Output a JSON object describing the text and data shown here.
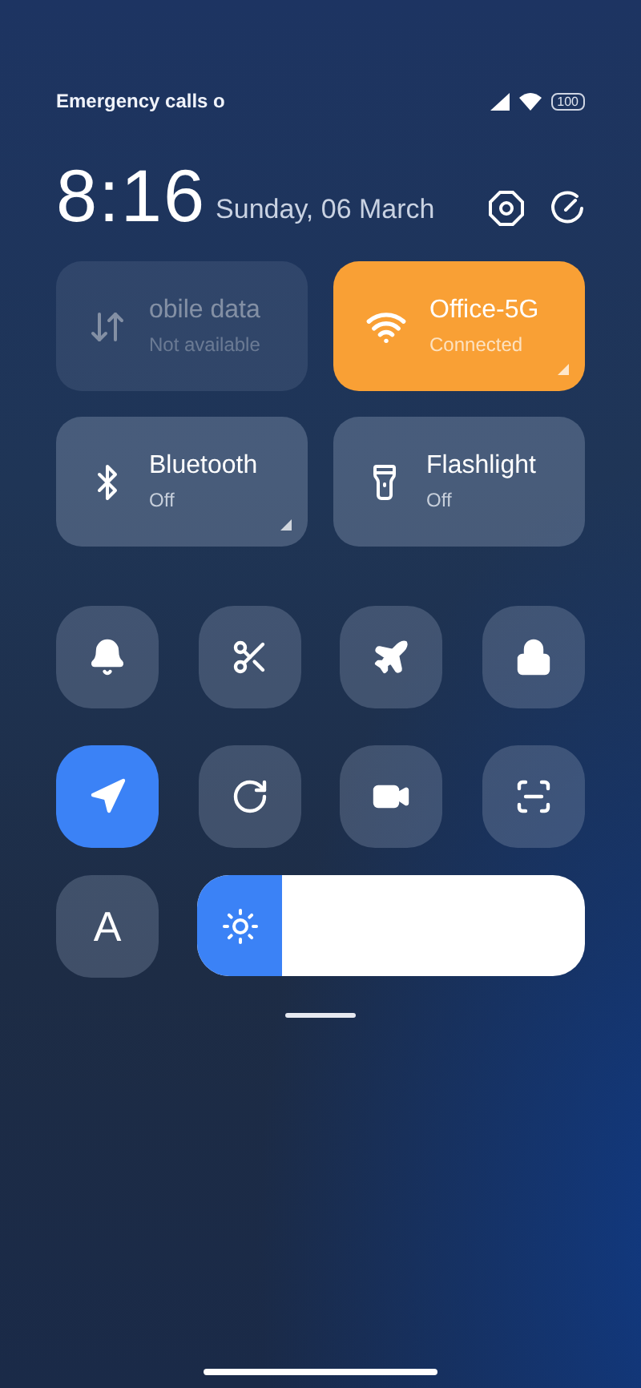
{
  "status_bar": {
    "carrier": "Emergency calls o",
    "battery": "100"
  },
  "header": {
    "time": "8:16",
    "date": "Sunday, 06 March"
  },
  "big_tiles": [
    {
      "kind": "data",
      "label": "obile data",
      "status": "Not available",
      "on": false,
      "disabled": true,
      "expandable": false
    },
    {
      "kind": "wifi",
      "label": "Office-5G",
      "status": "Connected",
      "on": true,
      "disabled": false,
      "expandable": true
    },
    {
      "kind": "bluetooth",
      "label": "Bluetooth",
      "status": "Off",
      "on": false,
      "disabled": false,
      "expandable": true
    },
    {
      "kind": "flashlight",
      "label": "Flashlight",
      "status": "Off",
      "on": false,
      "disabled": false,
      "expandable": false
    }
  ],
  "small_tiles": [
    {
      "kind": "bell",
      "on": false
    },
    {
      "kind": "screenshot",
      "on": false
    },
    {
      "kind": "airplane",
      "on": false
    },
    {
      "kind": "lock",
      "on": false
    },
    {
      "kind": "location",
      "on": true
    },
    {
      "kind": "rotation",
      "on": false
    },
    {
      "kind": "video",
      "on": false
    },
    {
      "kind": "scanner",
      "on": false
    }
  ],
  "auto_brightness": {
    "label": "A",
    "on": false
  },
  "brightness": {
    "level": 0.22
  }
}
